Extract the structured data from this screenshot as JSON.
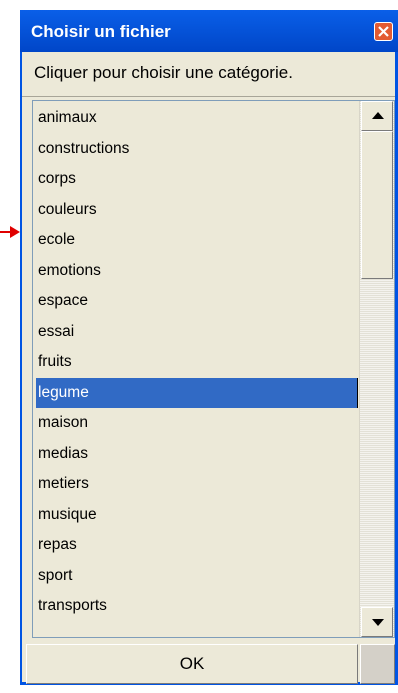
{
  "window": {
    "title": "Choisir un fichier",
    "close_icon": "close-icon",
    "accent": "#0054e3"
  },
  "subtitle": "Cliquer pour choisir une catégorie.",
  "list": {
    "selected": "legume",
    "selected_color": "#316ac5",
    "items": [
      {
        "label": "animaux"
      },
      {
        "label": "constructions"
      },
      {
        "label": "corps"
      },
      {
        "label": "couleurs"
      },
      {
        "label": "ecole"
      },
      {
        "label": "emotions"
      },
      {
        "label": "espace"
      },
      {
        "label": "essai"
      },
      {
        "label": "fruits"
      },
      {
        "label": "legume"
      },
      {
        "label": "maison"
      },
      {
        "label": "medias"
      },
      {
        "label": "metiers"
      },
      {
        "label": "musique"
      },
      {
        "label": "repas"
      },
      {
        "label": "sport"
      },
      {
        "label": "transports"
      }
    ]
  },
  "buttons": {
    "ok_label": "OK"
  },
  "pointer": {
    "icon": "arrow-pointer-icon",
    "color": "#e00000"
  }
}
